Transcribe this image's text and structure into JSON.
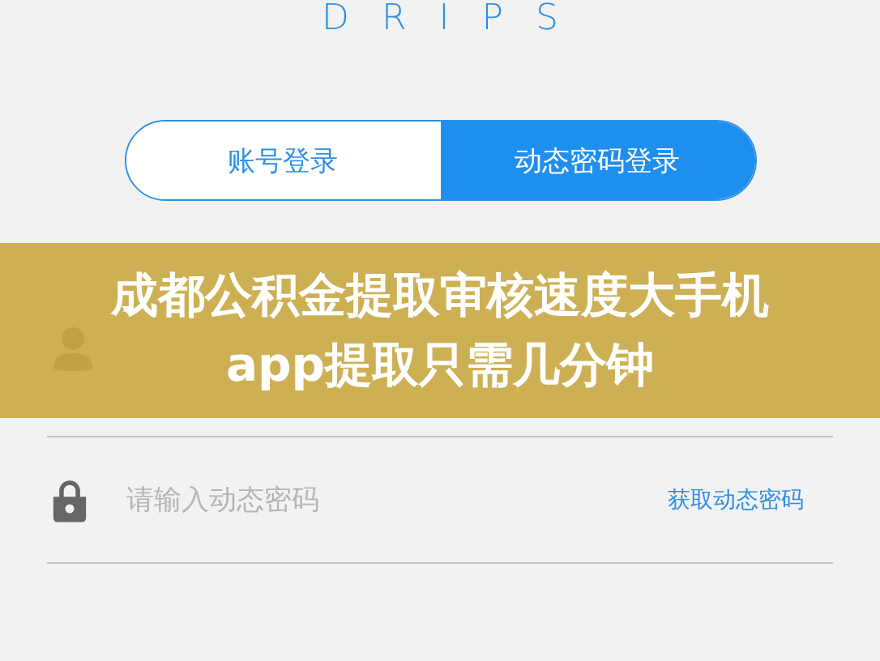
{
  "logo": "DRIPS",
  "login_tabs": [
    {
      "label": "账号登录",
      "selected": false
    },
    {
      "label": "动态密码登录",
      "selected": true
    }
  ],
  "password_field": {
    "placeholder": "请输入动态密码",
    "action": "获取动态密码"
  },
  "banner": {
    "title": "成都公积金提取审核速度大手机app提取只需几分钟"
  }
}
